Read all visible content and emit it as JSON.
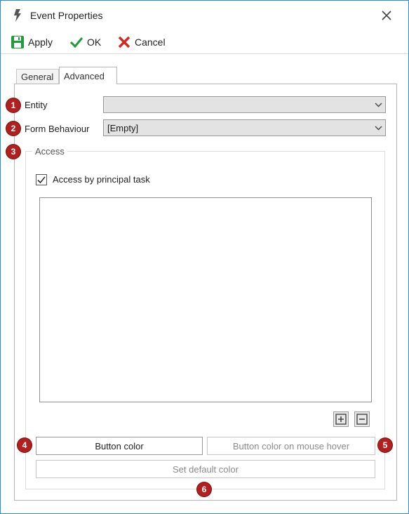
{
  "window": {
    "title": "Event Properties",
    "title_icon": "lightning-icon",
    "close_icon": "close-icon"
  },
  "toolbar": {
    "apply_label": "Apply",
    "ok_label": "OK",
    "cancel_label": "Cancel",
    "icons": {
      "apply": "save-icon",
      "ok": "checkmark-icon",
      "cancel": "x-icon"
    },
    "colors": {
      "apply": "#1e9b3a",
      "ok": "#1e9b3a",
      "cancel": "#d6261f"
    }
  },
  "tabs": [
    {
      "label": "General",
      "active": false
    },
    {
      "label": "Advanced",
      "active": true
    }
  ],
  "form": {
    "entity_label": "Entity",
    "entity_value": "",
    "form_behaviour_label": "Form Behaviour",
    "form_behaviour_value": "[Empty]",
    "access_group_title": "Access",
    "access_by_principal_task_label": "Access by principal task",
    "access_by_principal_task_checked": true,
    "access_list_items": [],
    "add_icon": "plus-box-icon",
    "remove_icon": "minus-box-icon",
    "button_color_label": "Button color",
    "button_color_hover_label": "Button color on mouse hover",
    "set_default_color_label": "Set default color"
  },
  "badges": [
    "1",
    "2",
    "3",
    "4",
    "5",
    "6"
  ],
  "badge_color": "#b21f1f",
  "accent_color": "#2b8fd6"
}
